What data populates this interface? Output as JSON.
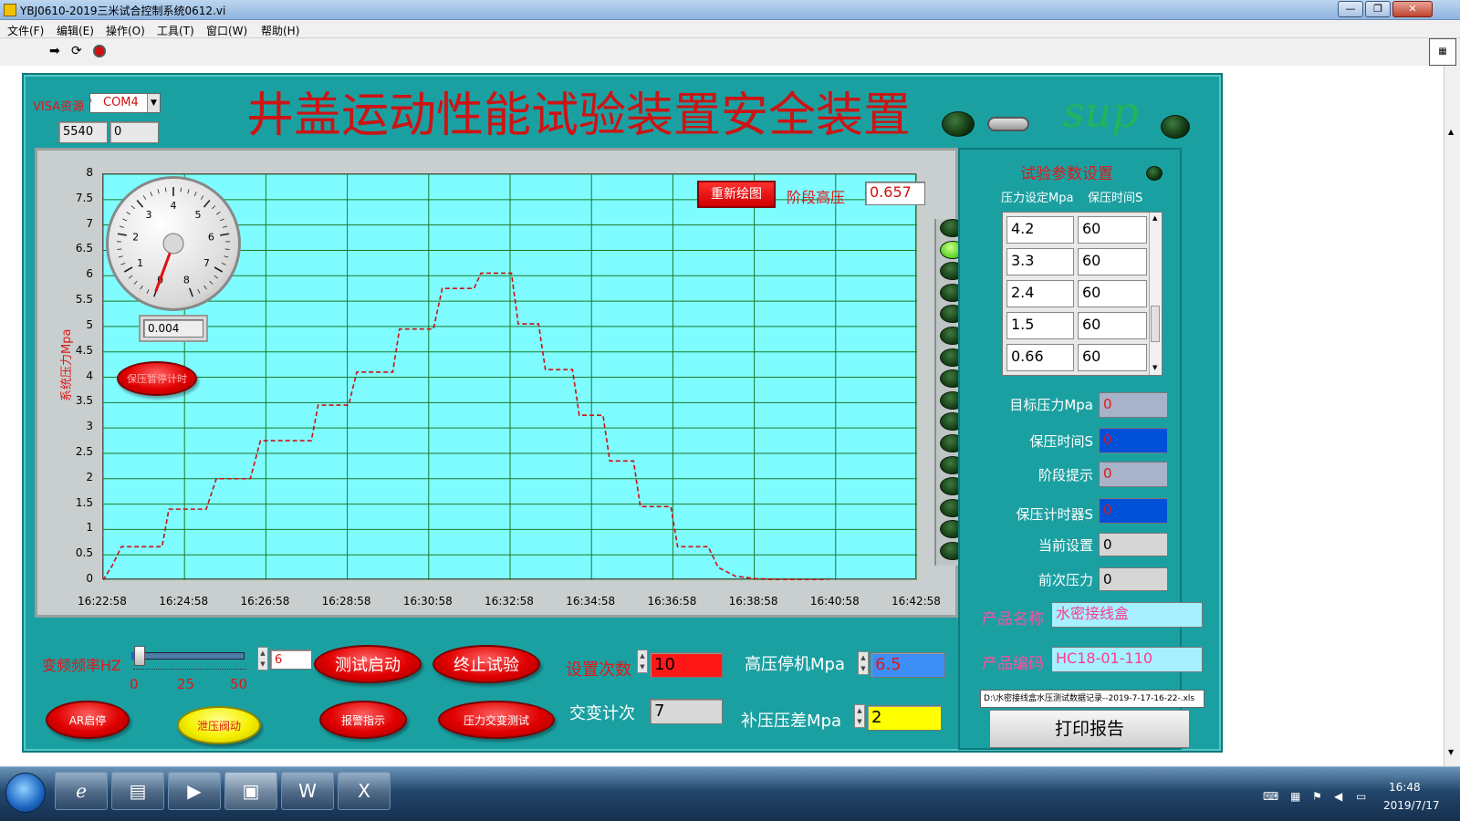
{
  "window": {
    "title": "YBJ0610-2019三米试合控制系统0612.vi"
  },
  "menu": [
    "文件(F)",
    "编辑(E)",
    "操作(O)",
    "工具(T)",
    "窗口(W)",
    "帮助(H)"
  ],
  "header": {
    "visa_label": "VISA资源",
    "visa_value": "COM4",
    "port_a": "5540",
    "port_b": "0",
    "main_title": "井盖运动性能试验装置安全装置",
    "watermark": "sup"
  },
  "graph": {
    "redraw_button": "重新绘图",
    "stage_label": "阶段高压",
    "stage_value": "0.657",
    "gauge_value": "0.004",
    "gauge_ticks": [
      "0",
      "1",
      "2",
      "3",
      "4",
      "5",
      "6",
      "7",
      "8"
    ],
    "hold_button": "保压暂停计时",
    "led_count": 16,
    "led_on_index": 1
  },
  "chart_data": {
    "type": "line",
    "ylabel": "系统压力Mpa",
    "xlabel": "",
    "ylim": [
      0,
      8
    ],
    "yticks": [
      "0",
      "0.5",
      "1",
      "1.5",
      "2",
      "2.5",
      "3",
      "3.5",
      "4",
      "4.5",
      "5",
      "5.5",
      "6",
      "6.5",
      "7",
      "7.5",
      "8"
    ],
    "xticks": [
      "16:22:58",
      "16:24:58",
      "16:26:58",
      "16:28:58",
      "16:30:58",
      "16:32:58",
      "16:34:58",
      "16:36:58",
      "16:38:58",
      "16:40:58",
      "16:42:58"
    ],
    "xlim": [
      "16:22:58",
      "16:42:58"
    ],
    "grid": true,
    "series": [
      {
        "color": "#cc1111",
        "x": [
          "16:22:58",
          "16:23:12",
          "16:23:25",
          "16:24:25",
          "16:24:35",
          "16:25:30",
          "16:25:45",
          "16:26:35",
          "16:26:50",
          "16:28:05",
          "16:28:15",
          "16:29:00",
          "16:29:12",
          "16:30:05",
          "16:30:15",
          "16:31:05",
          "16:31:18",
          "16:32:05",
          "16:32:15",
          "16:33:00",
          "16:33:10",
          "16:33:40",
          "16:33:50",
          "16:34:30",
          "16:34:40",
          "16:35:15",
          "16:35:25",
          "16:36:00",
          "16:36:10",
          "16:36:55",
          "16:37:05",
          "16:37:50",
          "16:38:05",
          "16:38:30",
          "16:39:00",
          "16:40:00",
          "16:40:48"
        ],
        "y": [
          0.0,
          0.3,
          0.66,
          0.66,
          1.4,
          1.4,
          2.0,
          2.0,
          2.75,
          2.75,
          3.45,
          3.45,
          4.1,
          4.1,
          4.95,
          4.95,
          5.75,
          5.75,
          6.05,
          6.05,
          5.05,
          5.05,
          4.15,
          4.15,
          3.25,
          3.25,
          2.35,
          2.35,
          1.45,
          1.45,
          0.66,
          0.66,
          0.25,
          0.08,
          0.03,
          0.01,
          0.0
        ]
      }
    ]
  },
  "params": {
    "title": "试验参数设置",
    "col1": "压力设定Mpa",
    "col2": "保压时间S",
    "rows": [
      [
        "4.2",
        "60"
      ],
      [
        "3.3",
        "60"
      ],
      [
        "2.4",
        "60"
      ],
      [
        "1.5",
        "60"
      ],
      [
        "0.66",
        "60"
      ]
    ]
  },
  "status": {
    "target_label": "目标压力Mpa",
    "target_value": "0",
    "hold_label": "保压时间S",
    "hold_value": "0",
    "stage_label": "阶段提示",
    "stage_value": "0",
    "timer_label": "保压计时器S",
    "timer_value": "0",
    "current_label": "当前设置",
    "current_value": "0",
    "prev_label": "前次压力",
    "prev_value": "0"
  },
  "product": {
    "name_label": "产品名称",
    "name_value": "水密接线盒",
    "code_label": "产品编码",
    "code_value": "HC18-01-110",
    "file_path": "D:\\水密接线盒水压测试数据记录--2019-7-17-16-22-.xls",
    "print_button": "打印报告"
  },
  "controls": {
    "freq_label": "变频频率HZ",
    "freq_value": "6",
    "freq_level": 0.06,
    "freq_ticks": [
      "0",
      "25",
      "50"
    ],
    "start_button": "测试启动",
    "stop_button": "终止试验",
    "set_count_label": "设置次数",
    "set_count_value": "10",
    "alt_count_label": "交变计次",
    "alt_count_value": "7",
    "high_stop_label": "高压停机Mpa",
    "high_stop_value": "6.5",
    "comp_label": "补压压差Mpa",
    "comp_value": "2",
    "ar_button": "AR启停",
    "release_button": "泄压阀动",
    "alarm_button": "报警指示",
    "alt_test_button": "压力交变测试"
  },
  "taskbar": {
    "time": "16:48",
    "date": "2019/7/17"
  }
}
